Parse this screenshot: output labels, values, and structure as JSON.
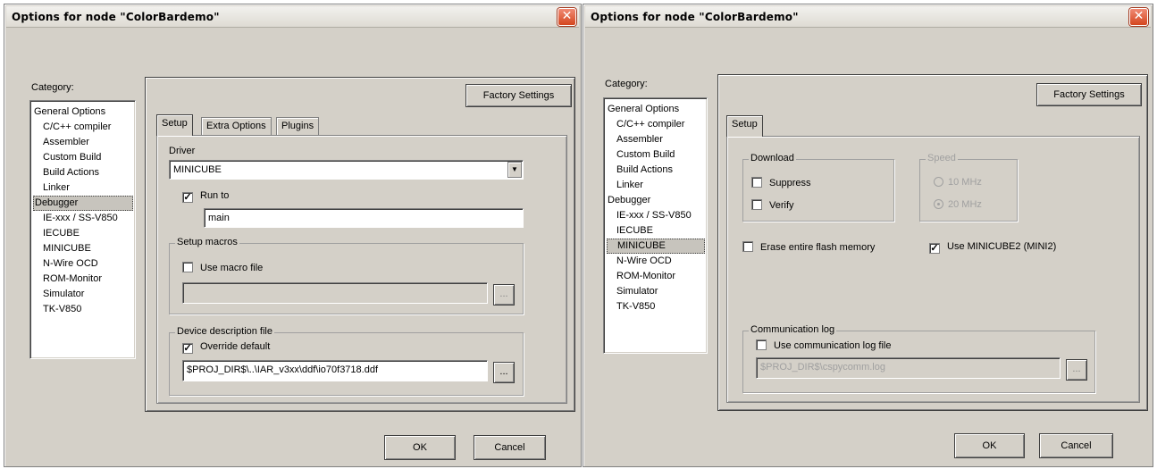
{
  "dialogs": [
    {
      "title": "Options for node \"ColorBardemo\"",
      "close_glyph": "✕",
      "category_label": "Category:",
      "categories": [
        "General Options",
        "C/C++ compiler",
        "Assembler",
        "Custom Build",
        "Build Actions",
        "Linker",
        "Debugger",
        "IE-xxx / SS-V850",
        "IECUBE",
        "MINICUBE",
        "N-Wire OCD",
        "ROM-Monitor",
        "Simulator",
        "TK-V850"
      ],
      "selected_category": "Debugger",
      "factory_settings": "Factory Settings",
      "tabs": [
        "Setup",
        "Extra Options",
        "Plugins"
      ],
      "active_tab": "Setup",
      "driver_label": "Driver",
      "driver_value": "MINICUBE",
      "run_to_label": "Run to",
      "run_to_checked": true,
      "run_to_value": "main",
      "setup_macros_title": "Setup macros",
      "use_macro_file_label": "Use macro file",
      "use_macro_file_checked": false,
      "macro_file_value": "",
      "device_desc_title": "Device description file",
      "override_default_label": "Override default",
      "override_default_checked": true,
      "device_file_value": "$PROJ_DIR$\\..\\IAR_v3xx\\ddf\\io70f3718.ddf",
      "browse_label": "...",
      "ok_label": "OK",
      "cancel_label": "Cancel"
    },
    {
      "title": "Options for node \"ColorBardemo\"",
      "close_glyph": "✕",
      "category_label": "Category:",
      "categories": [
        "General Options",
        "C/C++ compiler",
        "Assembler",
        "Custom Build",
        "Build Actions",
        "Linker",
        "Debugger",
        "IE-xxx / SS-V850",
        "IECUBE",
        "MINICUBE",
        "N-Wire OCD",
        "ROM-Monitor",
        "Simulator",
        "TK-V850"
      ],
      "selected_category": "MINICUBE",
      "factory_settings": "Factory Settings",
      "tabs": [
        "Setup"
      ],
      "active_tab": "Setup",
      "download_title": "Download",
      "suppress_label": "Suppress",
      "suppress_checked": false,
      "verify_label": "Verify",
      "verify_checked": false,
      "speed_title": "Speed",
      "speed_options": [
        "10 MHz",
        "20 MHz"
      ],
      "speed_selected": "20 MHz",
      "erase_label": "Erase entire flash memory",
      "erase_checked": false,
      "use_minicube2_label": "Use MINICUBE2 (MINI2)",
      "use_minicube2_checked": true,
      "comm_log_title": "Communication log",
      "use_comm_log_label": "Use communication log file",
      "use_comm_log_checked": false,
      "comm_log_value": "$PROJ_DIR$\\cspycomm.log",
      "browse_label": "...",
      "ok_label": "OK",
      "cancel_label": "Cancel"
    }
  ]
}
